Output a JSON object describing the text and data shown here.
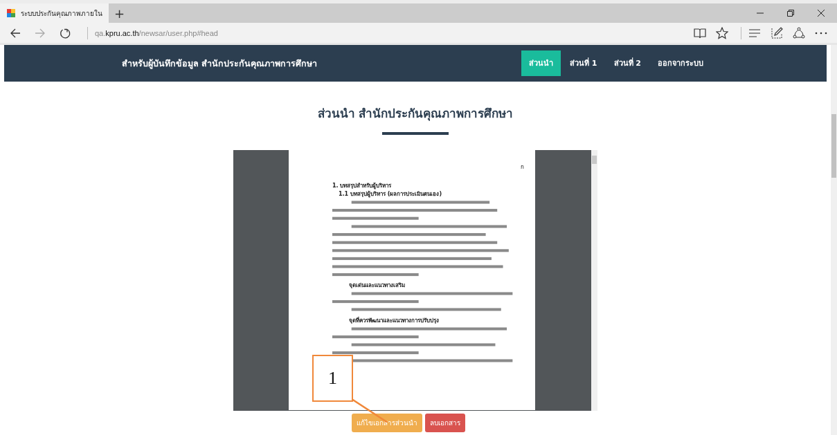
{
  "browser": {
    "tab_title": "ระบบประกันคุณภาพภายใน",
    "new_tab": "+",
    "url_host": "kpru.ac.th",
    "url_prefix": "qa.",
    "url_path": "/newsar/user.php#head"
  },
  "navbar": {
    "brand": "สำหรับผู้บันทึกข้อมูล สำนักประกันคุณภาพการศึกษา",
    "items": [
      {
        "label": "ส่วนนำ",
        "selected": true
      },
      {
        "label": "ส่วนที่ 1",
        "selected": false
      },
      {
        "label": "ส่วนที่ 2",
        "selected": false
      },
      {
        "label": "ออกจากระบบ",
        "selected": false
      }
    ]
  },
  "heading": "ส่วนนำ สำนักประกันคุณภาพการศึกษา",
  "document": {
    "page_mark": "ก",
    "blocks": [
      {
        "kind": "heading",
        "text": "1.  บทสรุปสำหรับผู้บริหาร"
      },
      {
        "kind": "subheading",
        "text": "1.1  บทสรุปผู้บริหาร  (ผลการประเมินตนเอง)"
      },
      {
        "kind": "paragraph"
      },
      {
        "kind": "paragraph"
      },
      {
        "kind": "section",
        "text": "จุดเด่นและแนวทางเสริม"
      },
      {
        "kind": "paragraph"
      },
      {
        "kind": "paragraph"
      },
      {
        "kind": "section",
        "text": "จุดที่ควรพัฒนาและแนวทางการปรับปรุง"
      },
      {
        "kind": "paragraph"
      },
      {
        "kind": "paragraph"
      },
      {
        "kind": "paragraph"
      }
    ]
  },
  "buttons": [
    {
      "label": "แก้ไขเอกสารส่วนนำ",
      "kind": "warning"
    },
    {
      "label": "ลบเอกสาร",
      "kind": "danger"
    }
  ],
  "annotation": {
    "label": "1"
  }
}
